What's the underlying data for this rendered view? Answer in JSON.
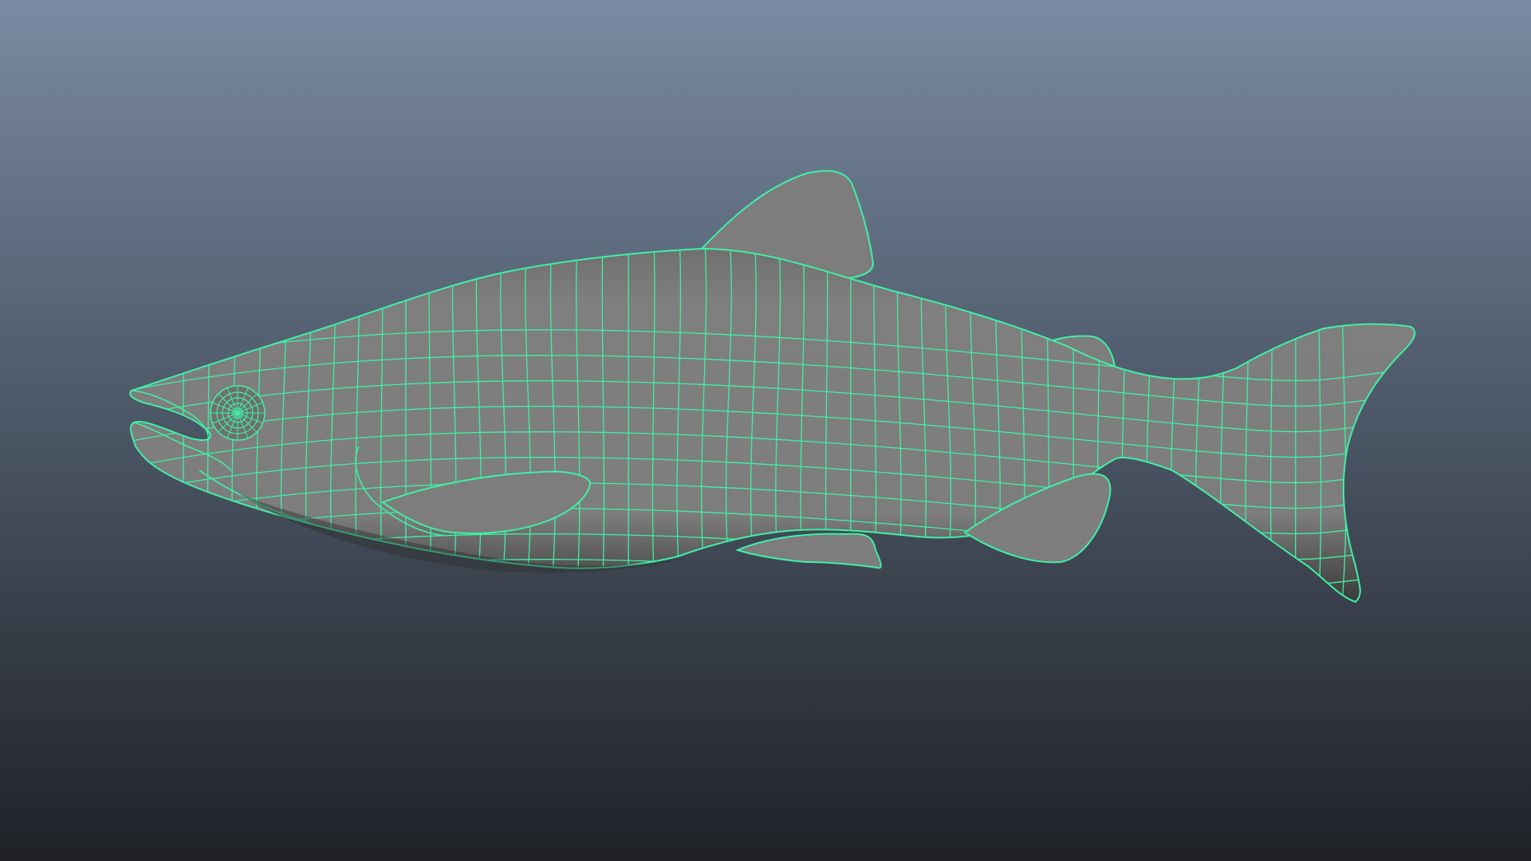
{
  "viewport": {
    "background_top": "#7a8aa2",
    "background_bottom": "#1f2126"
  },
  "model": {
    "object_name": "",
    "surface_color": "#7d7d7d",
    "wireframe_color": "#3ff0a6",
    "shadow_color": "#2e2e2e"
  },
  "icons": {
    "model": "fish-mesh-icon"
  }
}
